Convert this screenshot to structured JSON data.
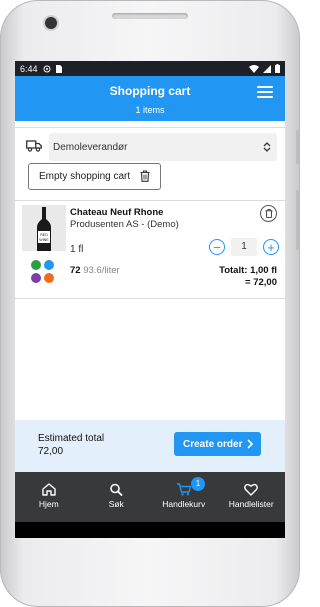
{
  "status_bar": {
    "time": "6:44"
  },
  "header": {
    "title": "Shopping cart",
    "item_count": "1 items"
  },
  "supplier": {
    "selected": "Demoleverandør"
  },
  "cart": {
    "empty_label": "Empty shopping cart"
  },
  "item": {
    "name": "Chateau Neuf Rhone",
    "producer": "Produsenten AS - (Demo)",
    "unit": "1 fl",
    "quantity": "1",
    "price": "72",
    "price_per_liter": "93.6/liter",
    "total_units": "Totalt: 1,00 fl",
    "total_amount": "= 72,00",
    "bottle_label": "RED WINE"
  },
  "summary": {
    "label": "Estimated total",
    "value": "72,00",
    "create_order": "Create order"
  },
  "tabs": [
    {
      "label": "Hjem",
      "icon": "home-icon"
    },
    {
      "label": "Søk",
      "icon": "search-icon"
    },
    {
      "label": "Handlekurv",
      "icon": "cart-icon",
      "badge": "1"
    },
    {
      "label": "Handlelister",
      "icon": "heart-icon"
    }
  ],
  "colors": {
    "primary": "#2196f3",
    "tabbar": "#37393b",
    "summary_bg": "#e3f0fc"
  }
}
